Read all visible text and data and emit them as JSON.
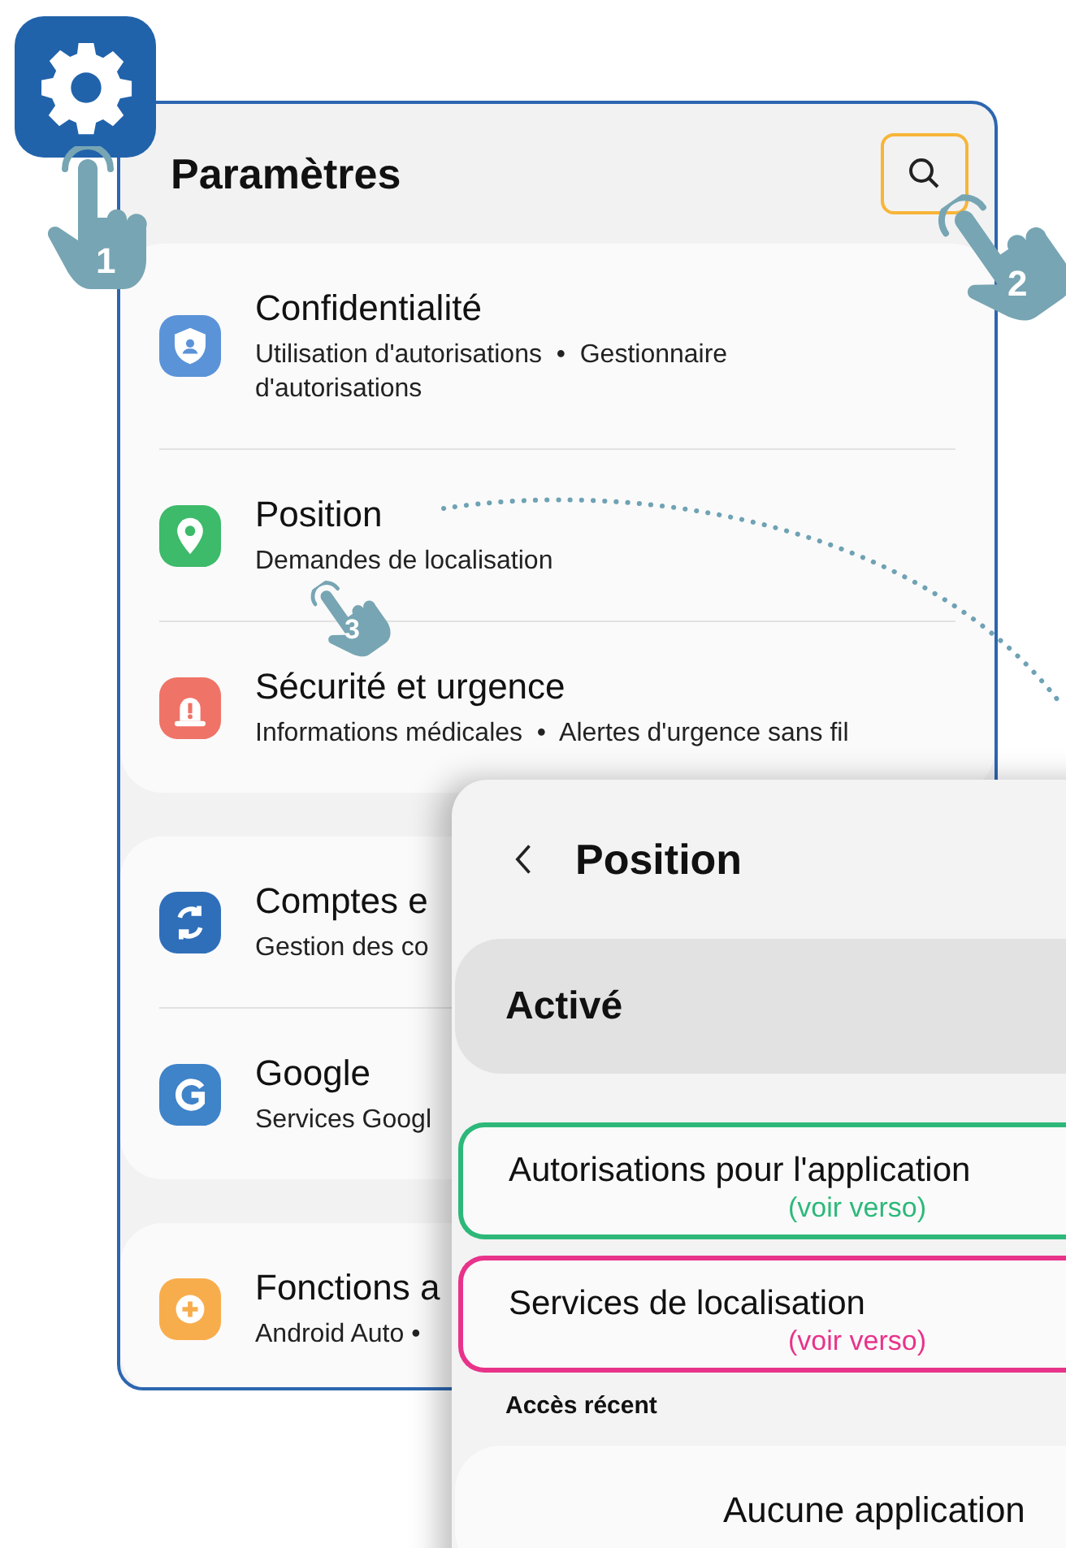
{
  "settings": {
    "title": "Paramètres",
    "groups": [
      {
        "items": [
          {
            "kind": "shield",
            "color": "#5b93d8",
            "title": "Confidentialité",
            "subtitle": "Utilisation d'autorisations  •  Gestionnaire d'autorisations"
          },
          {
            "kind": "pin",
            "color": "#3dba6a",
            "title": "Position",
            "subtitle": "Demandes de localisation"
          },
          {
            "kind": "alert",
            "color": "#ef7367",
            "title": "Sécurité et urgence",
            "subtitle": "Informations médicales  •  Alertes d'urgence sans fil"
          }
        ]
      },
      {
        "items": [
          {
            "kind": "sync",
            "color": "#2f6fba",
            "title": "Comptes e",
            "subtitle": "Gestion des co"
          },
          {
            "kind": "google",
            "color": "#3f83c9",
            "title": "Google",
            "subtitle": "Services Googl"
          }
        ]
      },
      {
        "items": [
          {
            "kind": "plus",
            "color": "#f8ad4c",
            "title": "Fonctions a",
            "subtitle": "Android Auto •"
          }
        ]
      }
    ]
  },
  "position_screen": {
    "title": "Position",
    "status": "Activé",
    "options": [
      {
        "label": "Autorisations pour l'application",
        "note": "(voir verso)",
        "color": "#2db87a"
      },
      {
        "label": "Services de localisation",
        "note": "(voir verso)",
        "color": "#e8338a"
      }
    ],
    "section": "Accès récent",
    "recent": "Aucune application"
  },
  "steps": [
    {
      "number": "1"
    },
    {
      "number": "2"
    },
    {
      "number": "3"
    }
  ]
}
